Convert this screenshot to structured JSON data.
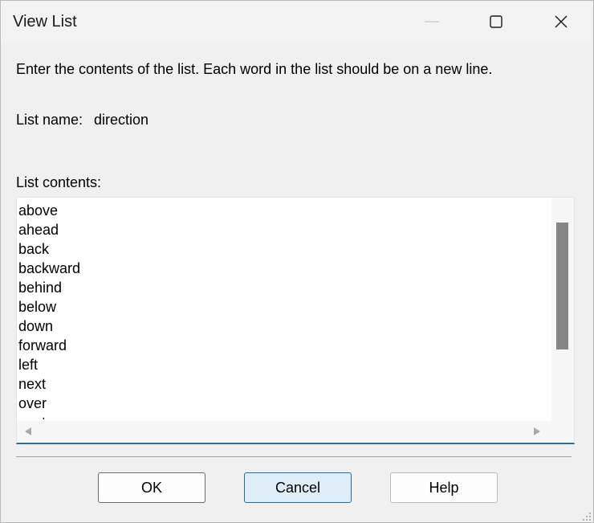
{
  "window": {
    "title": "View List"
  },
  "instruction": "Enter the contents of the list. Each word in the list should be on a new line.",
  "list_name": {
    "label": "List name:",
    "value": "direction"
  },
  "list_contents": {
    "label": "List contents:",
    "items": [
      "above",
      "ahead",
      "back",
      "backward",
      "behind",
      "below",
      "down",
      "forward",
      "left",
      "next",
      "over",
      "past"
    ]
  },
  "buttons": {
    "ok": "OK",
    "cancel": "Cancel",
    "help": "Help"
  },
  "icons": {
    "minimize": "minimize-icon",
    "maximize": "maximize-icon",
    "close": "close-icon",
    "scroll_left": "chevron-left-icon",
    "scroll_right": "chevron-right-icon",
    "resize_grip": "resize-grip-icon"
  },
  "colors": {
    "accent": "#1f6fb2",
    "scroll_thumb": "#858585",
    "dialog_bg": "#f0f0f0"
  }
}
